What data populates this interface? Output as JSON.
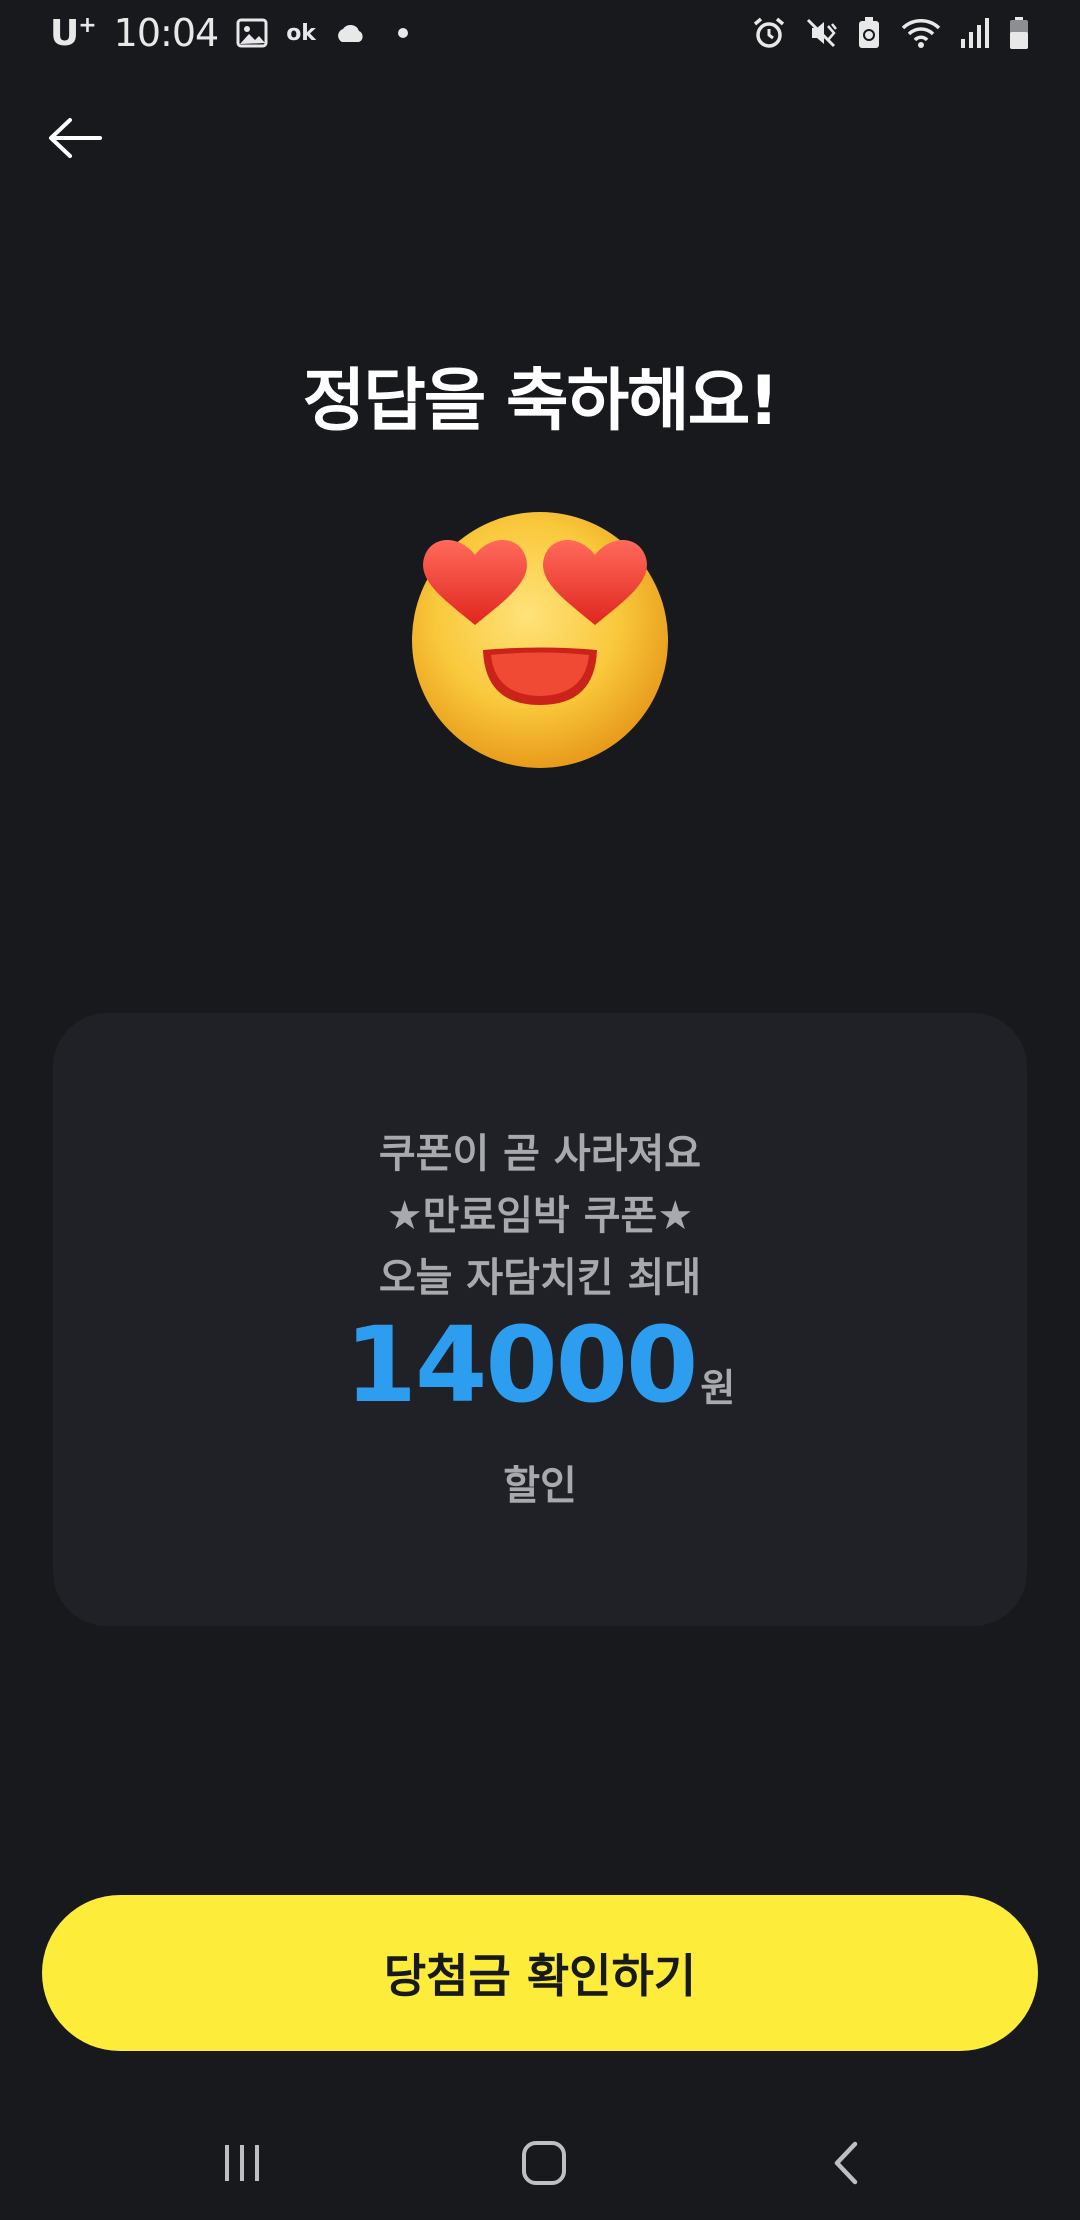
{
  "status_bar": {
    "carrier": "U",
    "carrier_sup": "+",
    "time": "10:04",
    "ok_label": "ok",
    "icons_left": [
      "image-icon",
      "ok-cashbag-icon",
      "cloud-icon",
      "notification-dot"
    ],
    "icons_right": [
      "alarm-icon",
      "vibrate-mute-icon",
      "battery-saver-icon",
      "wifi-icon",
      "signal-icon",
      "battery-icon"
    ]
  },
  "header": {
    "back_icon": "arrow-left-icon"
  },
  "main": {
    "title": "정답을 축하해요!",
    "emoji": "heart-eyes-emoji"
  },
  "coupon": {
    "line1": "쿠폰이 곧 사라져요",
    "line2": "★만료임박 쿠폰★",
    "line3": "오늘 자담치킨 최대",
    "amount": "14000",
    "currency": "원",
    "line4": "할인"
  },
  "cta": {
    "label": "당첨금 확인하기"
  },
  "nav_bar": {
    "items": [
      "recents-icon",
      "home-icon",
      "back-icon"
    ]
  },
  "colors": {
    "background": "#17191d",
    "card": "#1f2126",
    "accent_blue": "#2d9df0",
    "cta_yellow": "#fdec3a",
    "muted_text": "#a7a9ad"
  }
}
